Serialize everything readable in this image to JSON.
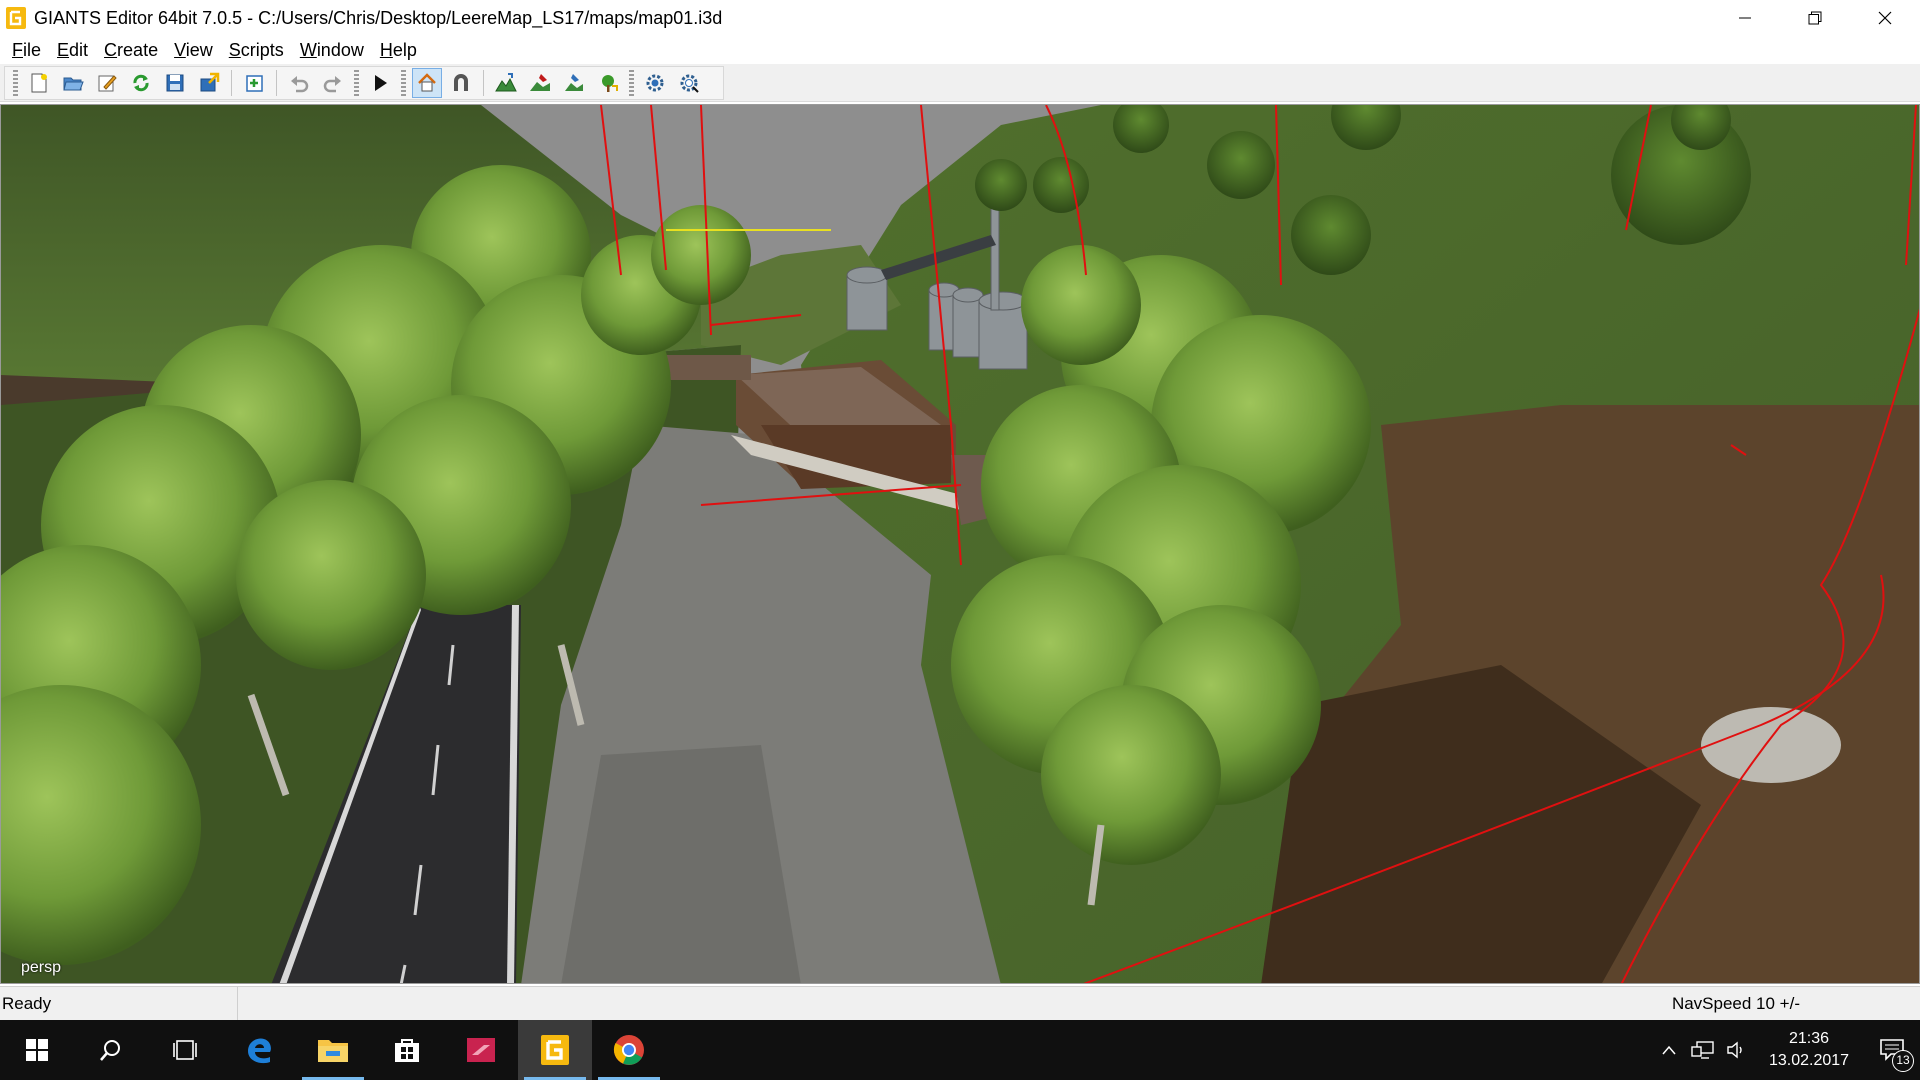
{
  "window": {
    "title": "GIANTS Editor 64bit 7.0.5 - C:/Users/Chris/Desktop/LeereMap_LS17/maps/map01.i3d",
    "app_icon": "giants-editor-icon",
    "controls": [
      "minimize-icon",
      "restore-icon",
      "close-icon"
    ]
  },
  "menu": {
    "items": [
      {
        "label": "File"
      },
      {
        "label": "Edit"
      },
      {
        "label": "Create"
      },
      {
        "label": "View"
      },
      {
        "label": "Scripts"
      },
      {
        "label": "Window"
      },
      {
        "label": "Help"
      }
    ]
  },
  "toolbar": {
    "buttons": [
      {
        "icon": "new-file-icon"
      },
      {
        "icon": "open-folder-icon"
      },
      {
        "icon": "edit-icon"
      },
      {
        "icon": "reload-icon"
      },
      {
        "icon": "save-icon"
      },
      {
        "icon": "export-icon"
      },
      {
        "icon": "import-icon"
      },
      {
        "icon": "undo-icon"
      },
      {
        "icon": "redo-icon"
      },
      {
        "icon": "play-icon"
      },
      {
        "icon": "home-icon",
        "active": true
      },
      {
        "icon": "snap-magnet-icon"
      },
      {
        "icon": "terrain-sculpt-icon"
      },
      {
        "icon": "terrain-paint-icon"
      },
      {
        "icon": "foliage-paint-icon"
      },
      {
        "icon": "tree-paint-icon"
      },
      {
        "icon": "settings-gear-icon"
      },
      {
        "icon": "settings-gear-alt-icon"
      }
    ]
  },
  "viewport": {
    "camera_label": "persp",
    "scene_description_icon": "3d-scene-viewport"
  },
  "status": {
    "left": "Ready",
    "right": "NavSpeed 10 +/-"
  },
  "taskbar": {
    "apps": [
      {
        "icon": "windows-start-icon"
      },
      {
        "icon": "search-icon"
      },
      {
        "icon": "task-view-icon"
      },
      {
        "icon": "edge-browser-icon"
      },
      {
        "icon": "file-explorer-icon",
        "running": true
      },
      {
        "icon": "store-icon"
      },
      {
        "icon": "red-app-icon"
      },
      {
        "icon": "giants-editor-taskbar-icon",
        "running": true,
        "active": true
      },
      {
        "icon": "chrome-icon",
        "running": true
      }
    ],
    "clock": {
      "time": "21:36",
      "date": "13.02.2017"
    },
    "notification_count": "13"
  },
  "colors": {
    "accent": "#f6b90f",
    "selection": "#cde4f7",
    "sky": "#8f8f8f",
    "grass": "#4f6a2e",
    "spline_red": "#e01010",
    "taskbar": "#101010"
  }
}
